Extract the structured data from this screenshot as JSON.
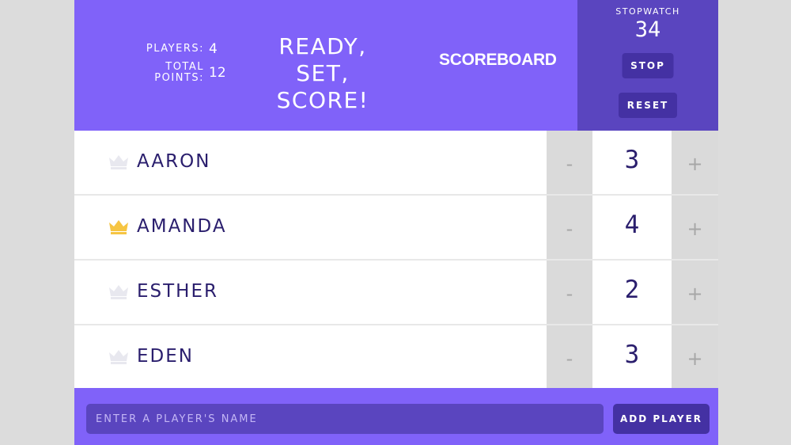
{
  "header": {
    "players_label": "PLAYERS:",
    "players_value": "4",
    "total_label_line1": "TOTAL",
    "total_label_line2": "POINTS:",
    "total_value": "12",
    "title_line1": "READY, SET,",
    "title_line2": "SCORE!",
    "scoreboard_label": "SCOREBOARD"
  },
  "stopwatch": {
    "label": "STOPWATCH",
    "time": "34",
    "stop_label": "STOP",
    "reset_label": "RESET"
  },
  "players": [
    {
      "name": "AARON",
      "score": "3",
      "crown": "crown-icon",
      "leader": false
    },
    {
      "name": "AMANDA",
      "score": "4",
      "crown": "crown-icon",
      "leader": true
    },
    {
      "name": "ESTHER",
      "score": "2",
      "crown": "crown-icon",
      "leader": false
    },
    {
      "name": "EDEN",
      "score": "3",
      "crown": "crown-icon",
      "leader": false
    }
  ],
  "row_controls": {
    "decrement_label": "-",
    "increment_label": "+"
  },
  "form": {
    "input_placeholder": "ENTER A PLAYER'S NAME",
    "input_value": "",
    "add_label": "ADD PLAYER"
  },
  "colors": {
    "header_bg": "#8062f9",
    "stopwatch_bg": "#5a45bf",
    "button_bg": "#4431a3",
    "crown_leader": "#f6c542",
    "crown_default": "#e8e8ef",
    "text_dark": "#2a1e6d"
  }
}
